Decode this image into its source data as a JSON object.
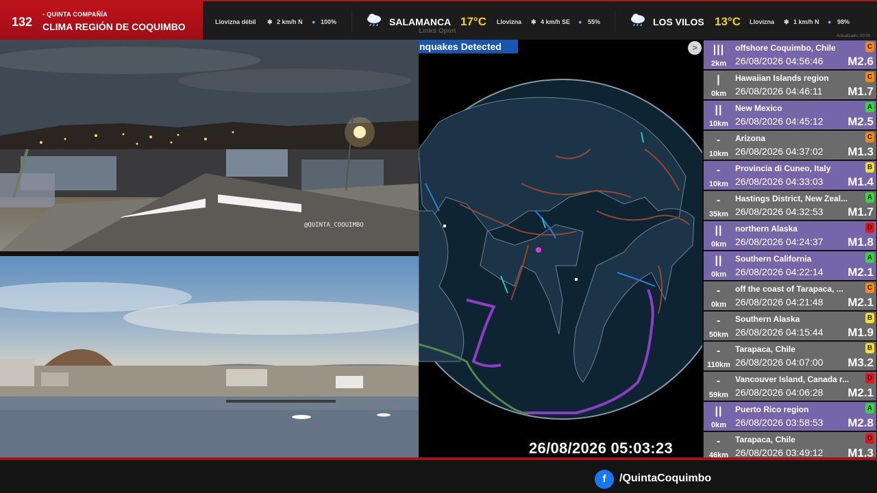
{
  "brand": {
    "channel_number": "132",
    "subtitle": "QUINTA COMPAÑÍA",
    "title": "CLIMA REGIÓN DE COQUIMBO"
  },
  "weather": {
    "local": {
      "condition": "Llovizna débil",
      "wind": "2 km/h N",
      "humidity": "100%"
    },
    "stations": [
      {
        "city": "SALAMANCA",
        "temp": "17°C",
        "condition": "Llovizna",
        "wind": "4 km/h SE",
        "humidity": "55%"
      },
      {
        "city": "LOS VILOS",
        "temp": "13°C",
        "condition": "Llovizna",
        "wind": "1 km/h N",
        "humidity": "98%"
      }
    ],
    "updated": "Actualizado: 00:00"
  },
  "cameras": {
    "watermark": "@QUINTA_COQUIMBO"
  },
  "map": {
    "header": "nquakes Detected",
    "tabs": "Links  Open",
    "next_glyph": ">",
    "clock": "26/08/2026 05:03:23"
  },
  "quakes": [
    {
      "bars": "|||",
      "depth": "2km",
      "place": "offshore Coquimbo, Chile",
      "time": "26/08/2026 04:56:46",
      "mag": "M2.6",
      "level": "C",
      "level_color": "#f28b14",
      "shade": "c0"
    },
    {
      "bars": "|",
      "depth": "0km",
      "place": "Hawaiian Islands region",
      "time": "26/08/2026 04:46:11",
      "mag": "M1.7",
      "level": "C",
      "level_color": "#f28b14",
      "shade": "c1"
    },
    {
      "bars": "||",
      "depth": "10km",
      "place": "New Mexico",
      "time": "26/08/2026 04:45:12",
      "mag": "M2.5",
      "level": "A",
      "level_color": "#3bd43b",
      "shade": "c0"
    },
    {
      "bars": "-",
      "depth": "10km",
      "place": "Arizona",
      "time": "26/08/2026 04:37:02",
      "mag": "M1.3",
      "level": "C",
      "level_color": "#f28b14",
      "shade": "c1"
    },
    {
      "bars": "-",
      "depth": "10km",
      "place": "Provincia di Cuneo, Italy",
      "time": "26/08/2026 04:33:03",
      "mag": "M1.4",
      "level": "B",
      "level_color": "#f2e02c",
      "shade": "c0"
    },
    {
      "bars": "-",
      "depth": "35km",
      "place": "Hastings District, New Zeal...",
      "time": "26/08/2026 04:32:53",
      "mag": "M1.7",
      "level": "A",
      "level_color": "#3bd43b",
      "shade": "c1"
    },
    {
      "bars": "||",
      "depth": "0km",
      "place": "northern Alaska",
      "time": "26/08/2026 04:24:37",
      "mag": "M1.8",
      "level": "D",
      "level_color": "#e3121b",
      "shade": "c0"
    },
    {
      "bars": "||",
      "depth": "0km",
      "place": "Southern California",
      "time": "26/08/2026 04:22:14",
      "mag": "M2.1",
      "level": "A",
      "level_color": "#3bd43b",
      "shade": "c0"
    },
    {
      "bars": "-",
      "depth": "0km",
      "place": "off the coast of Tarapaca, ...",
      "time": "26/08/2026 04:21:48",
      "mag": "M2.1",
      "level": "C",
      "level_color": "#f28b14",
      "shade": "c1"
    },
    {
      "bars": "-",
      "depth": "50km",
      "place": "Southern Alaska",
      "time": "26/08/2026 04:15:44",
      "mag": "M1.9",
      "level": "B",
      "level_color": "#f2e02c",
      "shade": "c1"
    },
    {
      "bars": "-",
      "depth": "110km",
      "place": "Tarapaca, Chile",
      "time": "26/08/2026 04:07:00",
      "mag": "M3.2",
      "level": "B",
      "level_color": "#f2e02c",
      "shade": "c1"
    },
    {
      "bars": "-",
      "depth": "59km",
      "place": "Vancouver Island, Canada r...",
      "time": "26/08/2026 04:06:28",
      "mag": "M2.1",
      "level": "D",
      "level_color": "#e3121b",
      "shade": "c1"
    },
    {
      "bars": "||",
      "depth": "0km",
      "place": "Puerto Rico region",
      "time": "26/08/2026 03:58:53",
      "mag": "M2.8",
      "level": "A",
      "level_color": "#3bd43b",
      "shade": "c0"
    },
    {
      "bars": "-",
      "depth": "46km",
      "place": "Tarapaca, Chile",
      "time": "26/08/2026 03:49:12",
      "mag": "M1.3",
      "level": "D",
      "level_color": "#e3121b",
      "shade": "c1"
    }
  ],
  "footer": {
    "facebook_glyph": "f",
    "handle": "/QuintaCoquimbo"
  }
}
